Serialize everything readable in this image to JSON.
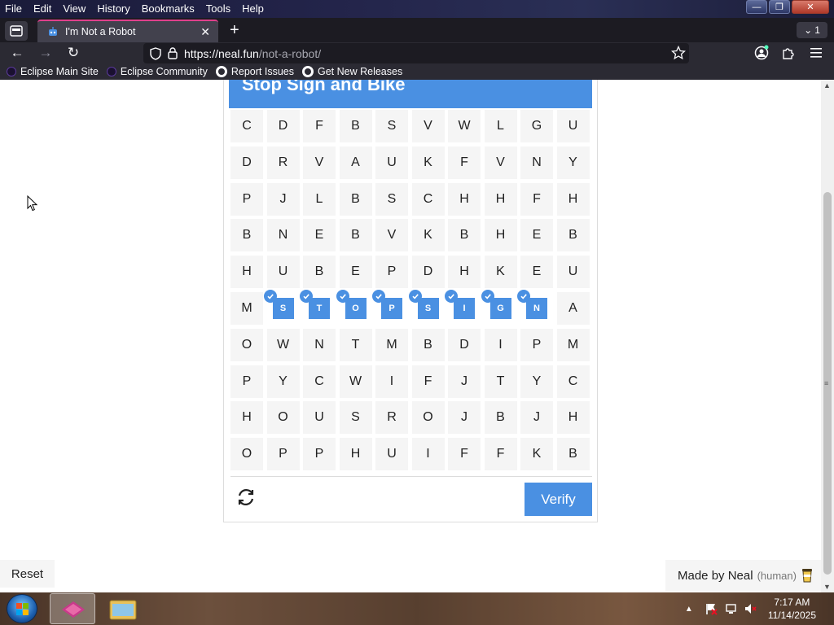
{
  "browser": {
    "menu": [
      "File",
      "Edit",
      "View",
      "History",
      "Bookmarks",
      "Tools",
      "Help"
    ],
    "tab_title": "I'm Not a Robot",
    "tab_count": "1",
    "url_host": "https://neal.fun",
    "url_path": "/not-a-robot/",
    "bookmarks": [
      "Eclipse Main Site",
      "Eclipse Community",
      "Report Issues",
      "Get New Releases"
    ]
  },
  "captcha": {
    "title": "Stop Sign and Bike",
    "grid": [
      [
        "C",
        "D",
        "F",
        "B",
        "S",
        "V",
        "W",
        "L",
        "G",
        "U"
      ],
      [
        "D",
        "R",
        "V",
        "A",
        "U",
        "K",
        "F",
        "V",
        "N",
        "Y"
      ],
      [
        "P",
        "J",
        "L",
        "B",
        "S",
        "C",
        "H",
        "H",
        "F",
        "H"
      ],
      [
        "B",
        "N",
        "E",
        "B",
        "V",
        "K",
        "B",
        "H",
        "E",
        "B"
      ],
      [
        "H",
        "U",
        "B",
        "E",
        "P",
        "D",
        "H",
        "K",
        "E",
        "U"
      ],
      [
        "M",
        "S",
        "T",
        "O",
        "P",
        "S",
        "I",
        "G",
        "N",
        "A"
      ],
      [
        "O",
        "W",
        "N",
        "T",
        "M",
        "B",
        "D",
        "I",
        "P",
        "M"
      ],
      [
        "P",
        "Y",
        "C",
        "W",
        "I",
        "F",
        "J",
        "T",
        "Y",
        "C"
      ],
      [
        "H",
        "O",
        "U",
        "S",
        "R",
        "O",
        "J",
        "B",
        "J",
        "H"
      ],
      [
        "O",
        "P",
        "P",
        "H",
        "U",
        "I",
        "F",
        "F",
        "K",
        "B"
      ]
    ],
    "selected": [
      [
        5,
        1
      ],
      [
        5,
        2
      ],
      [
        5,
        3
      ],
      [
        5,
        4
      ],
      [
        5,
        5
      ],
      [
        5,
        6
      ],
      [
        5,
        7
      ],
      [
        5,
        8
      ]
    ],
    "verify_label": "Verify"
  },
  "page": {
    "reset_label": "Reset",
    "made_by": "Made by Neal",
    "made_by_note": "(human)"
  },
  "taskbar": {
    "time": "7:17 AM",
    "date": "11/14/2025"
  },
  "colors": {
    "accent": "#4a90e2",
    "cell_bg": "#f5f5f5",
    "tab_highlight": "#e0408c"
  }
}
